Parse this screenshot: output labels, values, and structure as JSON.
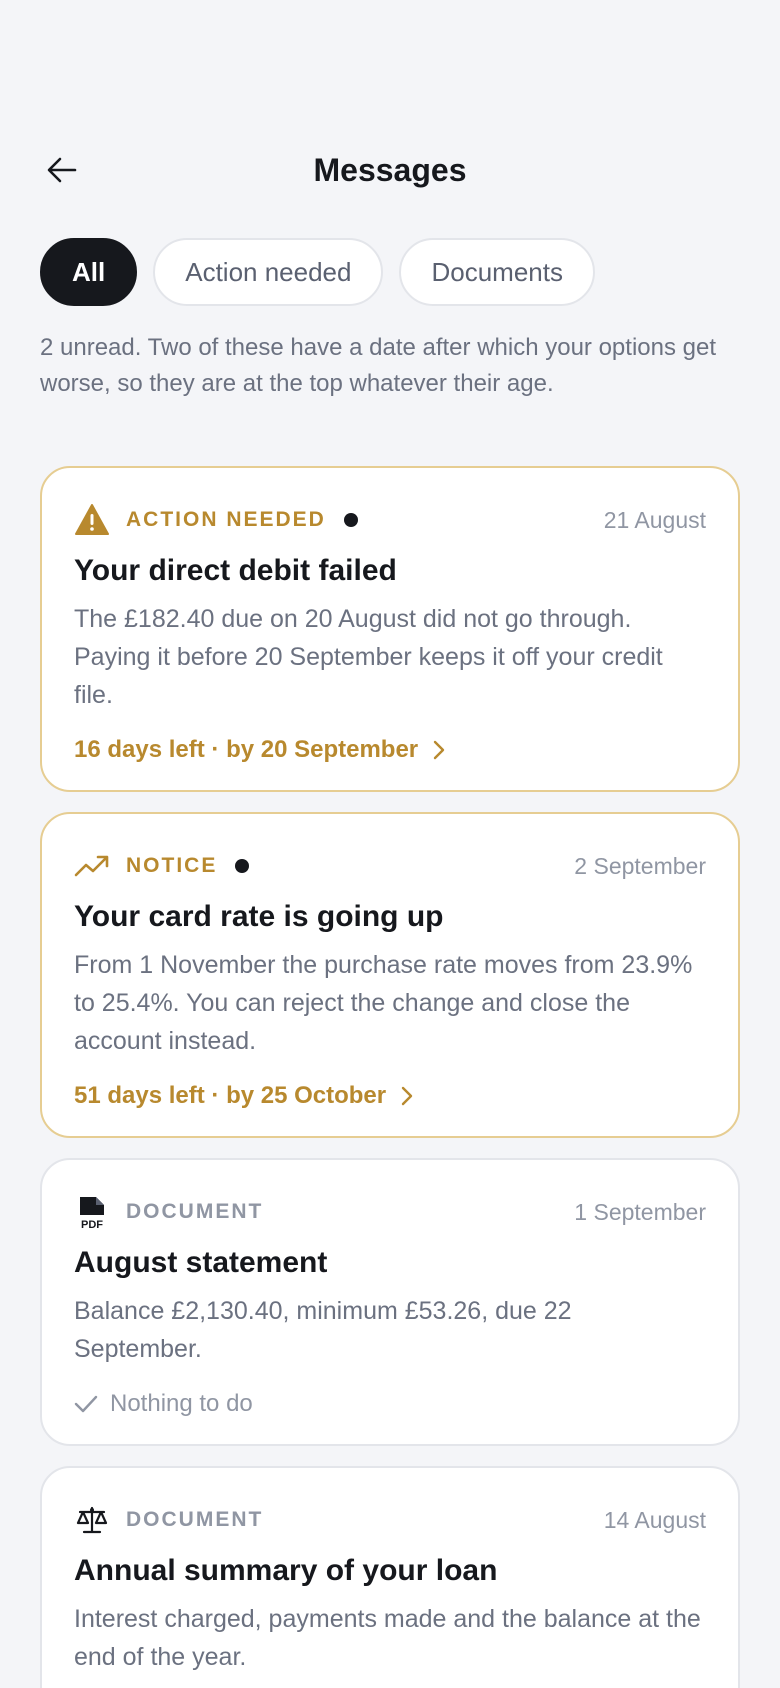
{
  "header": {
    "title": "Messages"
  },
  "filters": [
    {
      "label": "All",
      "active": true
    },
    {
      "label": "Action needed",
      "active": false
    },
    {
      "label": "Documents",
      "active": false
    }
  ],
  "intro": "2 unread. Two of these have a date after which your options get worse, so they are at the top whatever their age.",
  "messages": [
    {
      "kind": "ACTION NEEDED",
      "icon": "warning-triangle-icon",
      "unread": true,
      "date": "21 August",
      "title": "Your direct debit failed",
      "body": "The £182.40 due on 20 August did not go through. Paying it before 20 September keeps it off your credit file.",
      "footer": "16 days left · by 20 September"
    },
    {
      "kind": "NOTICE",
      "icon": "trending-up-icon",
      "unread": true,
      "date": "2 September",
      "title": "Your card rate is going up",
      "body": "From 1 November the purchase rate moves from 23.9% to 25.4%. You can reject the change and close the account instead.",
      "footer": "51 days left · by 25 October"
    },
    {
      "kind": "DOCUMENT",
      "icon": "pdf-file-icon",
      "unread": false,
      "date": "1 September",
      "title": "August statement",
      "body": "Balance £2,130.40, minimum £53.26, due 22 September.",
      "footer": "Nothing to do"
    },
    {
      "kind": "DOCUMENT",
      "icon": "scales-icon",
      "unread": false,
      "date": "14 August",
      "title": "Annual summary of your loan",
      "body": "Interest charged, payments made and the balance at the end of the year."
    }
  ],
  "colors": {
    "accent": "#b8892e",
    "background": "#f4f5f8",
    "text": "#16181d",
    "muted": "#6b7180"
  }
}
